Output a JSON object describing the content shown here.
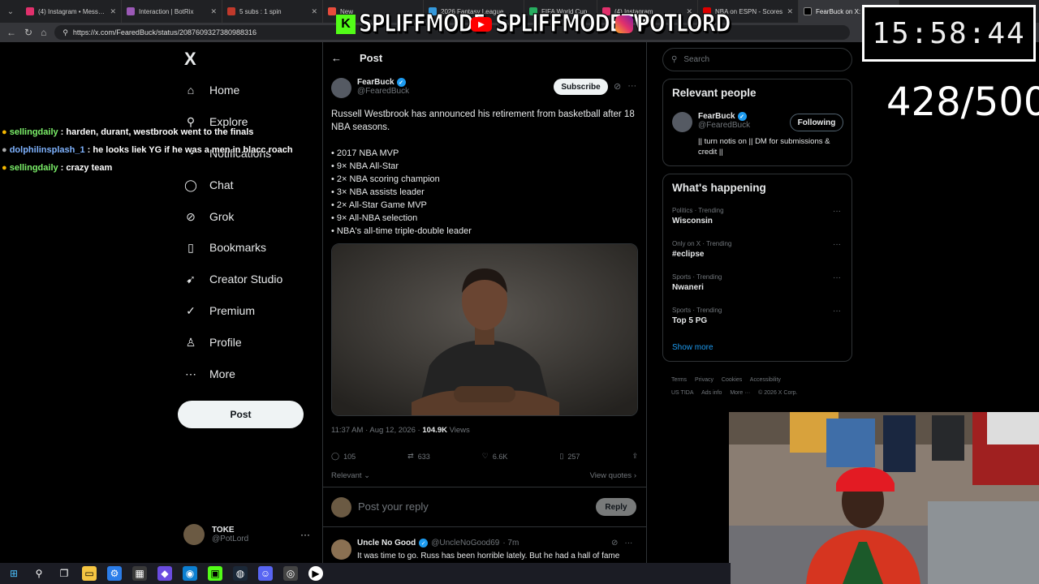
{
  "browser": {
    "tabs": [
      {
        "label": "(4) Instagram • Message",
        "color": "#e1306c"
      },
      {
        "label": "Interaction | BotRix",
        "color": "#9b59b6"
      },
      {
        "label": "5 subs : 1 spin",
        "color": "#c0392b"
      },
      {
        "label": "New",
        "color": "#e74c3c"
      },
      {
        "label": "2026 Fantasy League",
        "color": "#3498db"
      },
      {
        "label": "FIFA World Cup",
        "color": "#27ae60"
      },
      {
        "label": "(4) Instagram",
        "color": "#e1306c"
      },
      {
        "label": "NBA on ESPN - Scores",
        "color": "#d00"
      },
      {
        "label": "FearBuck on X: \"Russell",
        "color": "#000"
      }
    ],
    "url": "https://x.com/FearedBuck/status/2087609327380988316"
  },
  "overlay": {
    "timer": "15:58:44",
    "counter": "428/500",
    "banners": [
      "SPLIFFMODE",
      "SPLIFFMODETV",
      "POTLORD"
    ],
    "chat": [
      {
        "user": "sellingdaily",
        "message": "harden, durant, westbrook went to the finals"
      },
      {
        "user": "dolphilinsplash_1",
        "message": "he looks liek YG if he was a men in blacc roach"
      },
      {
        "user": "sellingdaily",
        "message": "crazy team"
      }
    ]
  },
  "sidebar": {
    "logo": "X",
    "items": [
      {
        "label": "Home",
        "icon": "home-icon"
      },
      {
        "label": "Explore",
        "icon": "search-icon"
      },
      {
        "label": "Notifications",
        "icon": "bell-icon"
      },
      {
        "label": "Chat",
        "icon": "chat-icon"
      },
      {
        "label": "Grok",
        "icon": "grok-icon"
      },
      {
        "label": "Bookmarks",
        "icon": "bookmark-icon"
      },
      {
        "label": "Creator Studio",
        "icon": "rocket-icon"
      },
      {
        "label": "Premium",
        "icon": "premium-icon"
      },
      {
        "label": "Profile",
        "icon": "profile-icon"
      },
      {
        "label": "More",
        "icon": "more-icon"
      }
    ],
    "post_label": "Post",
    "account": {
      "name": "TOKE",
      "handle": "@PotLord"
    }
  },
  "main": {
    "title": "Post",
    "author": {
      "name": "FearBuck",
      "handle": "@FearedBuck"
    },
    "subscribe_label": "Subscribe",
    "text": "Russell Westbrook has announced his retirement from basketball after 18 NBA seasons.",
    "bullets": [
      "• 2017 NBA MVP",
      "• 9× NBA All-Star",
      "• 2× NBA scoring champion",
      "• 3× NBA assists leader",
      "• 2× All-Star Game MVP",
      "• 9× All-NBA selection",
      "• NBA's all-time triple-double leader"
    ],
    "timestamp": "11:37 AM · Aug 12, 2026 · ",
    "views_count": "104.9K",
    "views_label": " Views",
    "stats": {
      "replies": "105",
      "reposts": "633",
      "likes": "6.6K",
      "bookmarks": "257"
    },
    "relevant_label": "Relevant",
    "view_quotes_label": "View quotes",
    "reply_placeholder": "Post your reply",
    "reply_button": "Reply",
    "comment": {
      "name": "Uncle No Good",
      "handle": "@UncleNoGood69",
      "time": "· 7m",
      "text": "It was time to go. Russ has been horrible lately. But he had a hall of fame"
    }
  },
  "right": {
    "search_placeholder": "Search",
    "relevant_people": {
      "title": "Relevant people",
      "name": "FearBuck",
      "handle": "@FearedBuck",
      "bio": "|| turn notis on || DM for submissions & credit ||",
      "following_label": "Following"
    },
    "happening": {
      "title": "What's happening",
      "trends": [
        {
          "category": "Politics · Trending",
          "topic": "Wisconsin"
        },
        {
          "category": "Only on X · Trending",
          "topic": "#eclipse"
        },
        {
          "category": "Sports · Trending",
          "topic": "Nwaneri"
        },
        {
          "category": "Sports · Trending",
          "topic": "Top 5 PG"
        }
      ],
      "show_more": "Show more"
    },
    "footer": [
      "Terms",
      "Privacy",
      "Cookies",
      "Accessibility",
      "US TIDA",
      "Ads info",
      "More ···",
      "© 2026 X Corp."
    ]
  },
  "colors": {
    "accent": "#1d9bf0",
    "background": "#000000",
    "border": "#2f3336",
    "muted": "#71767b"
  }
}
